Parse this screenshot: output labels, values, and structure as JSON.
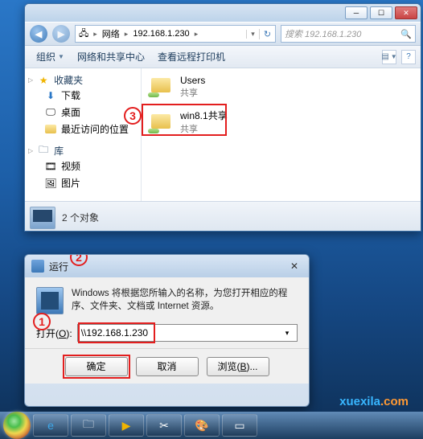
{
  "explorer": {
    "breadcrumb": {
      "root": "网络",
      "ip": "192.168.1.230"
    },
    "search_placeholder": "搜索 192.168.1.230",
    "toolbar": {
      "organize": "组织",
      "network_center": "网络和共享中心",
      "view_printers": "查看远程打印机"
    },
    "sidebar": {
      "favorites": {
        "label": "收藏夹",
        "download": "下载",
        "desktop": "桌面",
        "recent": "最近访问的位置"
      },
      "libraries": {
        "label": "库",
        "videos": "视频",
        "pictures": "图片"
      }
    },
    "folders": [
      {
        "name": "Users",
        "sub": "共享"
      },
      {
        "name": "win8.1共享",
        "sub": "共享"
      }
    ],
    "status": "2 个对象"
  },
  "callouts": {
    "c1": "1",
    "c2": "2",
    "c3": "3"
  },
  "run": {
    "title": "运行",
    "desc": "Windows 将根据您所输入的名称，为您打开相应的程序、文件夹、文档或 Internet 资源。",
    "open_label_pre": "打开(",
    "open_label_key": "O",
    "open_label_post": "):",
    "value": "\\\\192.168.1.230",
    "ok": "确定",
    "cancel": "取消",
    "browse_pre": "浏览(",
    "browse_key": "B",
    "browse_post": ")..."
  },
  "watermark": {
    "a": "xuexila",
    "b": ".com"
  }
}
